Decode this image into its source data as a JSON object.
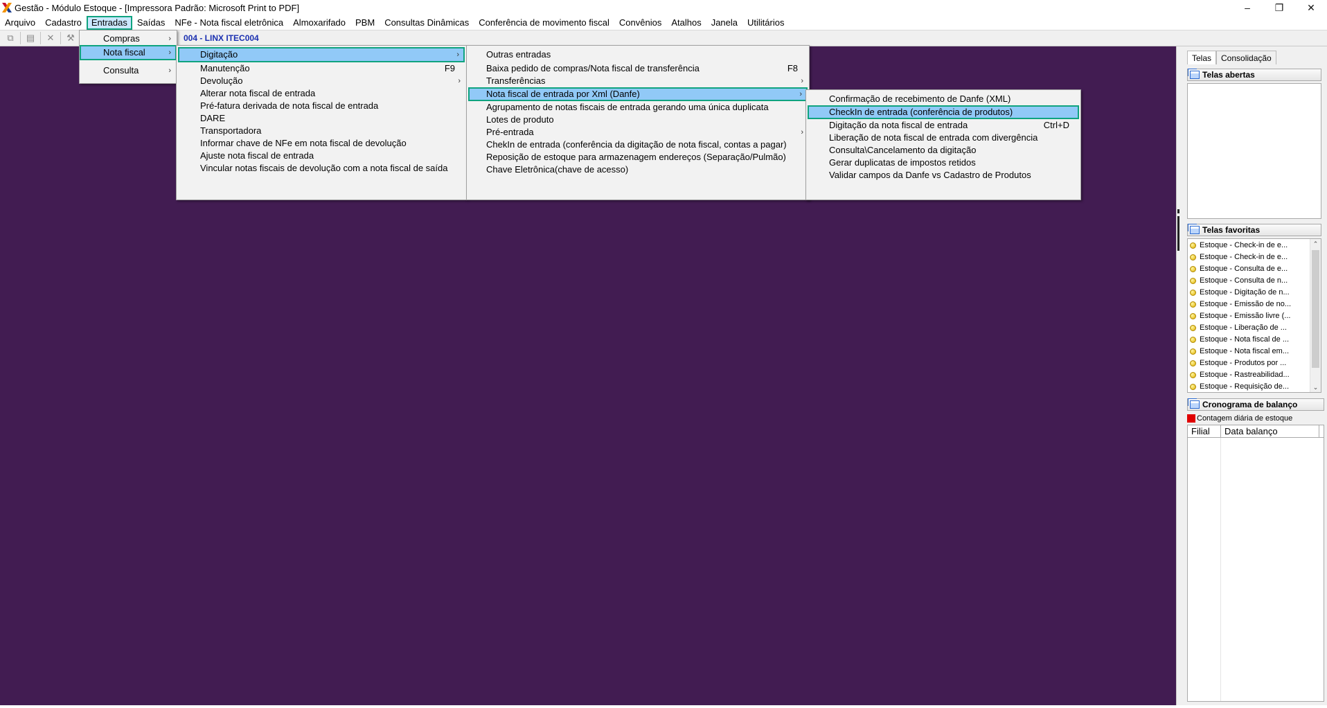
{
  "window": {
    "title": "Gestão  - Módulo Estoque - [Impressora Padrão: Microsoft Print to PDF]",
    "minimize": "–",
    "restore": "❐",
    "close": "✕"
  },
  "menubar": {
    "items": [
      "Arquivo",
      "Cadastro",
      "Entradas",
      "Saídas",
      "NFe - Nota fiscal eletrônica",
      "Almoxarifado",
      "PBM",
      "Consultas Dinâmicas",
      "Conferência de movimento fiscal",
      "Convênios",
      "Atalhos",
      "Janela",
      "Utilitários"
    ],
    "active": "Entradas"
  },
  "toolbar": {
    "company": "004 - LINX ITEC004"
  },
  "menus": {
    "entradas": {
      "items": [
        {
          "label": "Compras",
          "submenu": true
        },
        {
          "label": "Nota fiscal",
          "submenu": true,
          "highlighted": true
        },
        {
          "label": "Consulta",
          "submenu": true
        }
      ]
    },
    "nota_fiscal": {
      "items": [
        {
          "label": "Digitação",
          "submenu": true,
          "highlighted": true
        },
        {
          "label": "Manutenção",
          "shortcut": "F9"
        },
        {
          "label": "Devolução",
          "submenu": true
        },
        {
          "label": "Alterar nota fiscal de entrada"
        },
        {
          "label": "Pré-fatura derivada de nota fiscal de entrada"
        },
        {
          "label": "DARE"
        },
        {
          "label": "Transportadora"
        },
        {
          "label": "Informar chave de NFe em nota fiscal de devolução"
        },
        {
          "label": "Ajuste nota fiscal de entrada"
        },
        {
          "label": "Vincular notas fiscais de devolução com a nota fiscal de saída"
        }
      ]
    },
    "digitacao": {
      "items": [
        {
          "label": "Outras entradas"
        },
        {
          "label": "Baixa pedido de compras/Nota fiscal de transferência",
          "shortcut": "F8"
        },
        {
          "label": "Transferências",
          "submenu": true
        },
        {
          "label": "Nota fiscal de entrada por Xml (Danfe)",
          "submenu": true,
          "highlighted": true
        },
        {
          "label": "Agrupamento de notas fiscais de entrada gerando uma única duplicata"
        },
        {
          "label": "Lotes de produto"
        },
        {
          "label": "Pré-entrada",
          "submenu": true
        },
        {
          "label": "ChekIn de entrada (conferência da digitação de nota fiscal, contas a pagar)"
        },
        {
          "label": "Reposição de estoque para armazenagem endereços (Separação/Pulmão)"
        },
        {
          "label": "Chave Eletrônica(chave de acesso)"
        }
      ]
    },
    "xml_danfe": {
      "items": [
        {
          "label": "Confirmação de recebimento de Danfe (XML)"
        },
        {
          "label": "CheckIn de entrada (conferência de produtos)",
          "highlighted": true
        },
        {
          "label": "Digitação da nota fiscal de entrada",
          "shortcut": "Ctrl+D"
        },
        {
          "label": "Liberação de nota fiscal de entrada com divergência"
        },
        {
          "label": "Consulta\\Cancelamento da digitação"
        },
        {
          "label": "Gerar duplicatas de impostos retidos"
        },
        {
          "label": "Validar campos da Danfe vs Cadastro de Produtos"
        }
      ]
    }
  },
  "right_panel": {
    "tabs": [
      "Telas",
      "Consolidação"
    ],
    "open_screens_title": "Telas abertas",
    "favorites_title": "Telas favoritas",
    "favorites": [
      "Estoque - Check-in de e...",
      "Estoque - Check-in de e...",
      "Estoque - Consulta de e...",
      "Estoque - Consulta de n...",
      "Estoque - Digitação de n...",
      "Estoque - Emissão de no...",
      "Estoque - Emissão livre (...",
      "Estoque - Liberação de ...",
      "Estoque - Nota fiscal de ...",
      "Estoque - Nota fiscal em...",
      "Estoque - Produtos por ...",
      "Estoque - Rastreabilidad...",
      "Estoque - Requisição de..."
    ],
    "schedule_title": "Cronograma de balanço",
    "schedule_legend": "Contagem diária de estoque",
    "schedule_columns": [
      "Filial",
      "Data balanço"
    ]
  },
  "colors": {
    "workspace": "#421c52",
    "highlight": "#91c9f7",
    "focus_border": "#0fa37f"
  }
}
